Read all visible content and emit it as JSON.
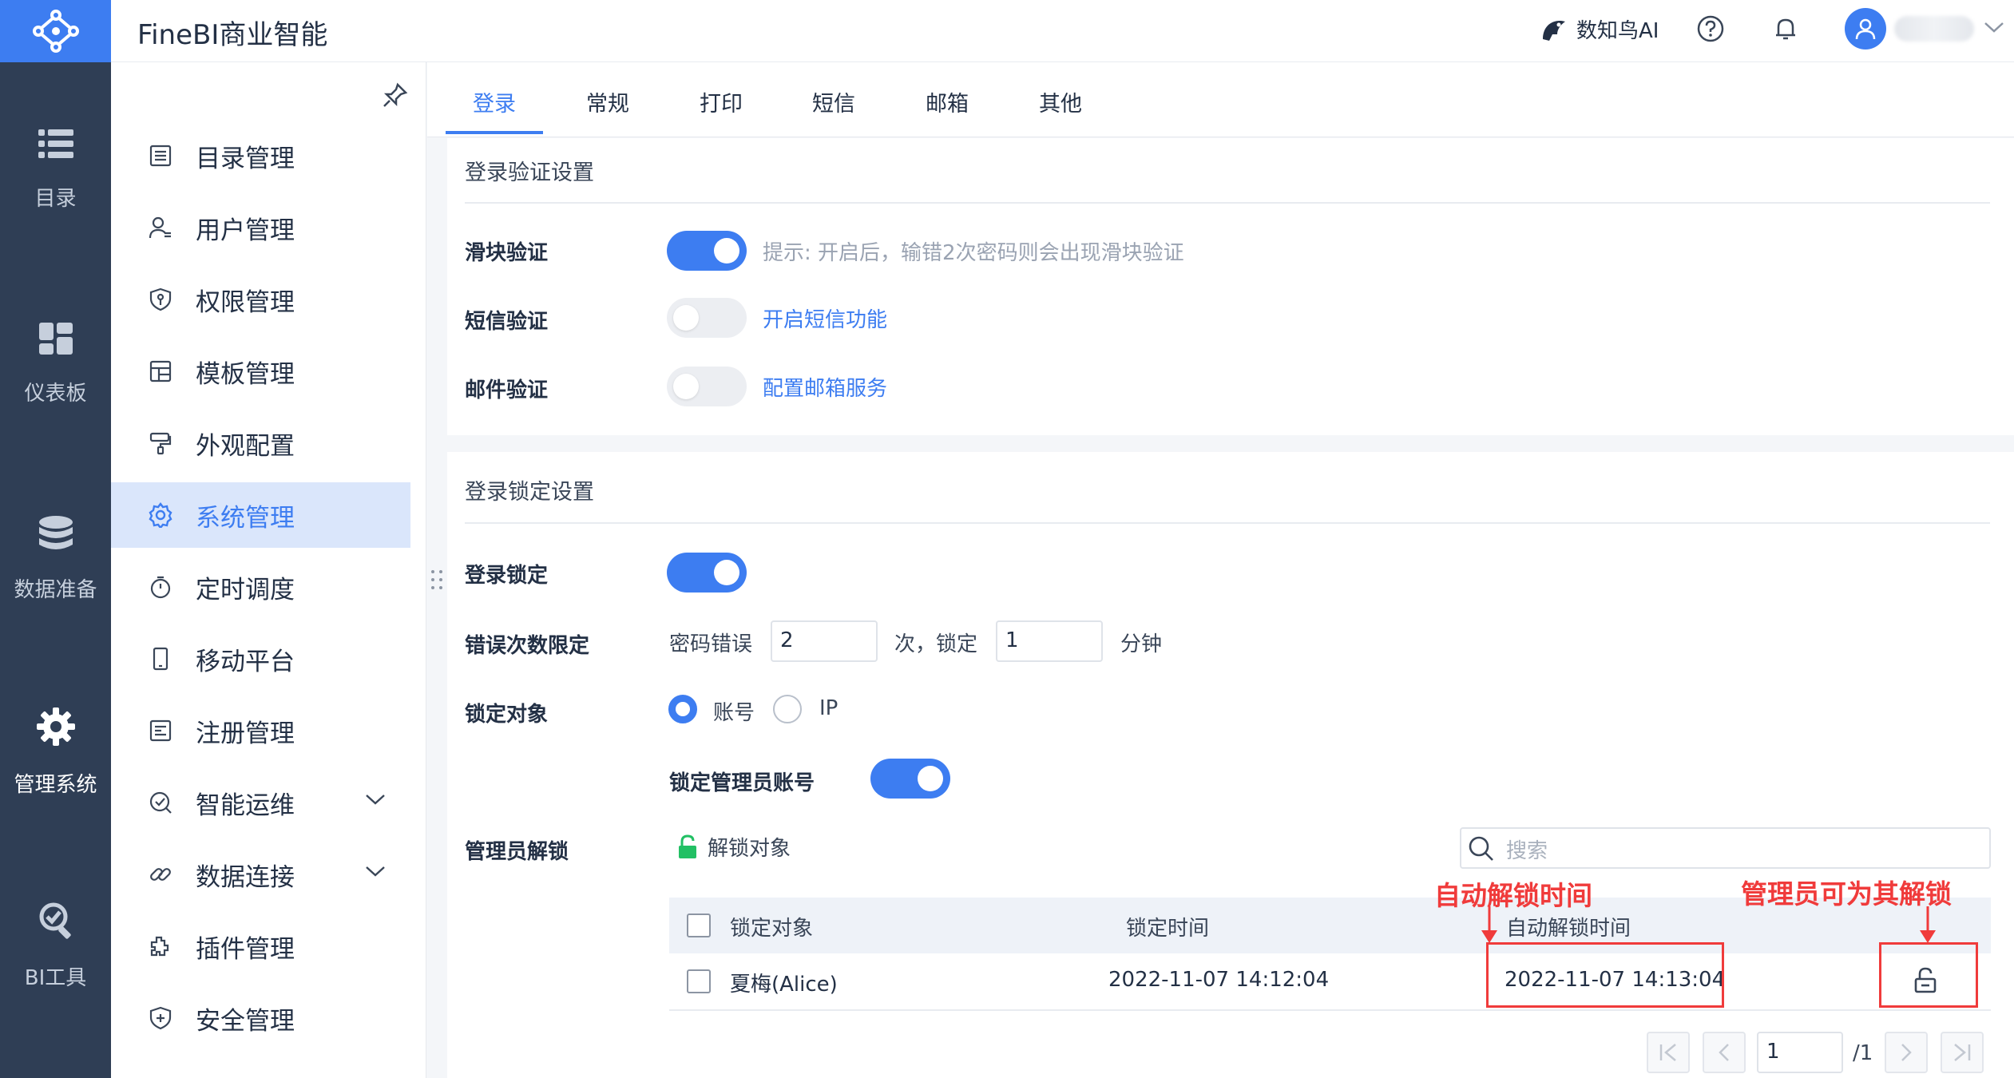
{
  "app": {
    "title": "FineBI商业智能"
  },
  "colors": {
    "accent": "#3d7df1",
    "rail": "#2f3e55",
    "annotation": "#f03b3b",
    "success": "#22c064"
  },
  "rail": [
    {
      "label": "目录",
      "icon": "list-icon"
    },
    {
      "label": "仪表板",
      "icon": "dashboard-icon"
    },
    {
      "label": "数据准备",
      "icon": "database-icon"
    },
    {
      "label": "管理系统",
      "icon": "gear-icon",
      "active": true
    },
    {
      "label": "BI工具",
      "icon": "wrench-icon"
    }
  ],
  "topbar": {
    "ai_label": "数知鸟AI"
  },
  "nav": [
    {
      "label": "目录管理",
      "icon": "catalog-icon"
    },
    {
      "label": "用户管理",
      "icon": "user-icon"
    },
    {
      "label": "权限管理",
      "icon": "shield-key-icon"
    },
    {
      "label": "模板管理",
      "icon": "template-icon"
    },
    {
      "label": "外观配置",
      "icon": "paint-roller-icon"
    },
    {
      "label": "系统管理",
      "icon": "gear-icon",
      "active": true
    },
    {
      "label": "定时调度",
      "icon": "stopwatch-icon"
    },
    {
      "label": "移动平台",
      "icon": "mobile-icon"
    },
    {
      "label": "注册管理",
      "icon": "register-icon"
    },
    {
      "label": "智能运维",
      "icon": "ops-icon",
      "expandable": true
    },
    {
      "label": "数据连接",
      "icon": "link-icon",
      "expandable": true
    },
    {
      "label": "插件管理",
      "icon": "plugin-icon"
    },
    {
      "label": "安全管理",
      "icon": "shield-plus-icon"
    }
  ],
  "tabs": [
    "登录",
    "常规",
    "打印",
    "短信",
    "邮箱",
    "其他"
  ],
  "verify": {
    "title": "登录验证设置",
    "slider_label": "滑块验证",
    "slider_hint": "提示: 开启后，输错2次密码则会出现滑块验证",
    "sms_label": "短信验证",
    "sms_link": "开启短信功能",
    "mail_label": "邮件验证",
    "mail_link": "配置邮箱服务"
  },
  "lock": {
    "title": "登录锁定设置",
    "lock_label": "登录锁定",
    "limit_label": "错误次数限定",
    "pwd_error": "密码错误",
    "times_value": "2",
    "times_suffix": "次，锁定",
    "minutes_value": "1",
    "minutes_suffix": "分钟",
    "target_label": "锁定对象",
    "opt_account": "账号",
    "opt_ip": "IP",
    "admin_lock_label": "锁定管理员账号",
    "admin_unlock_label": "管理员解锁",
    "unlock_button": "解锁对象",
    "search_placeholder": "搜索"
  },
  "table": {
    "headers": [
      "锁定对象",
      "锁定时间",
      "自动解锁时间"
    ],
    "rows": [
      {
        "target": "夏梅(Alice)",
        "lock_time": "2022-11-07 14:12:04",
        "auto_unlock": "2022-11-07 14:13:04"
      }
    ]
  },
  "annotations": {
    "auto_unlock": "自动解锁时间",
    "admin_unlock": "管理员可为其解锁"
  },
  "pagination": {
    "page": "1",
    "total": "/1"
  }
}
